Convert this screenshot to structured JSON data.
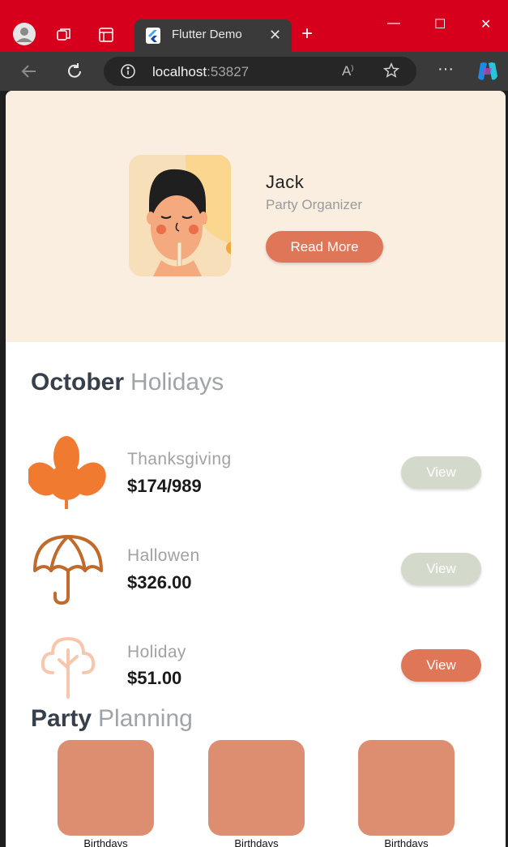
{
  "browser": {
    "tab_title": "Flutter Demo",
    "url_host": "localhost",
    "url_port": ":53827"
  },
  "profile": {
    "name": "Jack",
    "role": "Party Organizer",
    "button": "Read More"
  },
  "holidays_section": {
    "title_bold": "October",
    "title_light": "Holidays"
  },
  "holidays": [
    {
      "name": "Thanksgiving",
      "price": "$174/989",
      "button": "View",
      "icon": "maple-leaf-icon",
      "active": false
    },
    {
      "name": "Hallowen",
      "price": "$326.00",
      "button": "View",
      "icon": "umbrella-icon",
      "active": false
    },
    {
      "name": "Holiday",
      "price": "$51.00",
      "button": "View",
      "icon": "tree-icon",
      "active": true
    }
  ],
  "party_section": {
    "title_bold": "Party",
    "title_light": "Planning"
  },
  "party_cards": [
    {
      "label": "Birthdays"
    },
    {
      "label": "Birthdays"
    },
    {
      "label": "Birthdays"
    }
  ],
  "colors": {
    "titlebar": "#d6001c",
    "hero_bg": "#faeee0",
    "accent": "#df7658",
    "view_inactive": "#d4dacb",
    "card": "#dd8e71"
  }
}
